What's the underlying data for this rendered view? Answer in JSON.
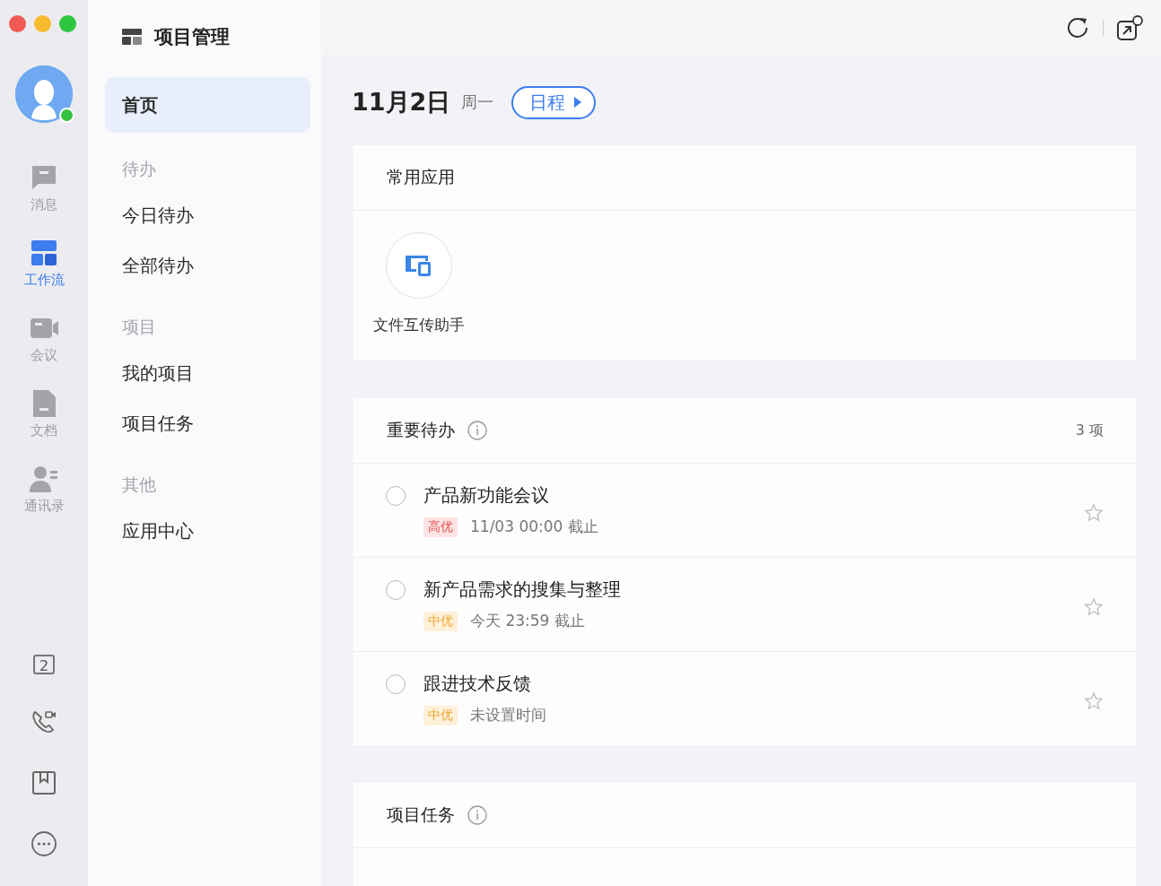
{
  "rail": {
    "avatar": {
      "online": true
    },
    "items": [
      {
        "label": "消息",
        "kind": "message",
        "selected": false
      },
      {
        "label": "工作流",
        "kind": "workflow",
        "selected": true
      },
      {
        "label": "会议",
        "kind": "meeting",
        "selected": false
      },
      {
        "label": "文档",
        "kind": "document",
        "selected": false
      },
      {
        "label": "通讯录",
        "kind": "contacts",
        "selected": false
      }
    ],
    "bottom": [
      {
        "kind": "calendar",
        "day": "2"
      },
      {
        "kind": "call"
      },
      {
        "kind": "bookmark"
      },
      {
        "kind": "more"
      }
    ]
  },
  "nav": {
    "title": "项目管理",
    "groups": [
      {
        "items": [
          {
            "label": "首页",
            "selected": true
          }
        ]
      },
      {
        "heading": "待办",
        "items": [
          {
            "label": "今日待办",
            "selected": false
          },
          {
            "label": "全部待办",
            "selected": false
          }
        ]
      },
      {
        "heading": "项目",
        "items": [
          {
            "label": "我的项目",
            "selected": false
          },
          {
            "label": "项目任务",
            "selected": false
          }
        ]
      },
      {
        "heading": "其他",
        "items": [
          {
            "label": "应用中心",
            "selected": false
          }
        ]
      }
    ]
  },
  "main": {
    "date": "11月2日",
    "weekday": "周一",
    "schedule_button": "日程",
    "apps_card": {
      "title": "常用应用",
      "apps": [
        {
          "label": "文件互传助手"
        }
      ]
    },
    "todo_card": {
      "title": "重要待办",
      "count": "3 项",
      "tasks": [
        {
          "title": "产品新功能会议",
          "priority": "高优",
          "kind": "high",
          "due": "11/03 00:00 截止",
          "checked": false,
          "starred": false
        },
        {
          "title": "新产品需求的搜集与整理",
          "priority": "中优",
          "kind": "medium",
          "due": "今天 23:59 截止",
          "checked": false,
          "starred": false
        },
        {
          "title": "跟进技术反馈",
          "priority": "中优",
          "kind": "medium",
          "due": "未设置时间",
          "checked": false,
          "starred": false
        }
      ]
    },
    "tasks_card": {
      "title": "项目任务"
    }
  }
}
